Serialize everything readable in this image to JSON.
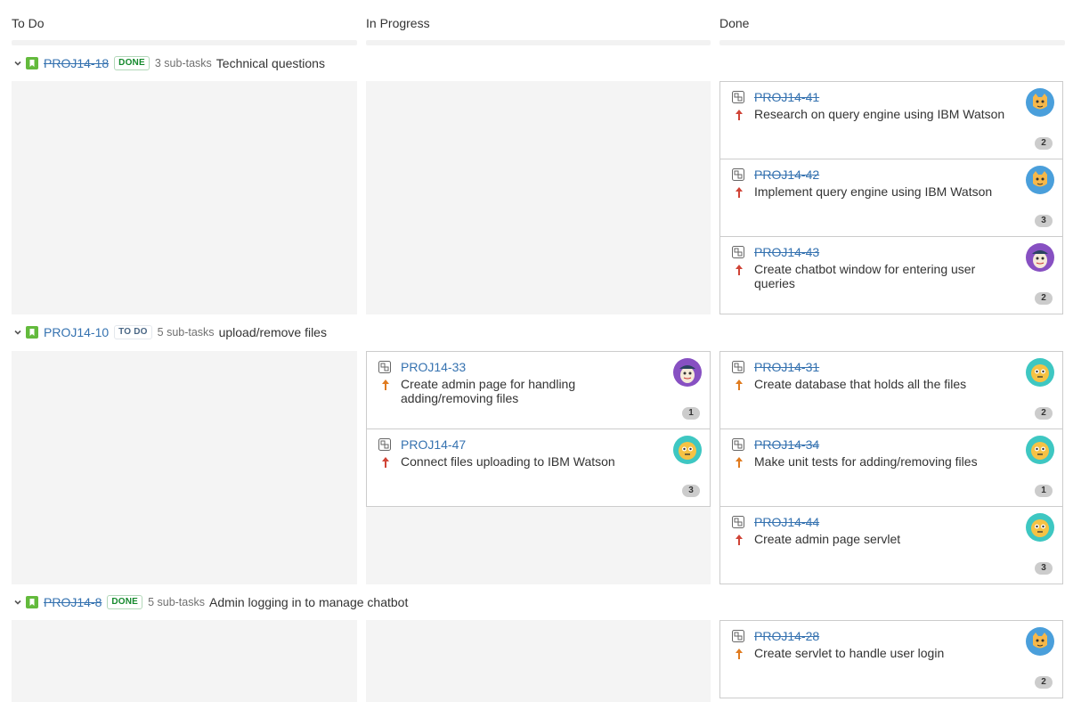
{
  "columns": [
    {
      "title": "To Do"
    },
    {
      "title": "In Progress"
    },
    {
      "title": "Done"
    }
  ],
  "colors": {
    "link": "#3572b0",
    "done_green": "#14892c",
    "story_green": "#63ba3c",
    "priority_high": "#d04437",
    "priority_medium": "#e07b1f"
  },
  "swimlanes": [
    {
      "key": "PROJ14-18",
      "status": "DONE",
      "subtasks": "3 sub-tasks",
      "summary": "Technical questions",
      "done_cards": [
        {
          "key": "PROJ14-41",
          "summary": "Research on query engine using IBM Watson",
          "priority": "high",
          "avatar": "cat-avatar",
          "badge": "2"
        },
        {
          "key": "PROJ14-42",
          "summary": "Implement query engine using IBM Watson",
          "priority": "high",
          "avatar": "cat-avatar",
          "badge": "3"
        },
        {
          "key": "PROJ14-43",
          "summary": "Create chatbot window for entering user queries",
          "priority": "high",
          "avatar": "captain-avatar",
          "badge": "2"
        }
      ]
    },
    {
      "key": "PROJ14-10",
      "status": "TO DO",
      "subtasks": "5 sub-tasks",
      "summary": "upload/remove files",
      "in_progress_cards": [
        {
          "key": "PROJ14-33",
          "summary": "Create admin page for handling adding/removing files",
          "priority": "medium",
          "avatar": "captain-avatar",
          "badge": "1"
        },
        {
          "key": "PROJ14-47",
          "summary": "Connect files uploading to IBM Watson",
          "priority": "high",
          "avatar": "monster-avatar",
          "badge": "3"
        }
      ],
      "done_cards": [
        {
          "key": "PROJ14-31",
          "summary": "Create database that holds all the files",
          "priority": "medium",
          "avatar": "monster-avatar",
          "badge": "2"
        },
        {
          "key": "PROJ14-34",
          "summary": "Make unit tests for adding/removing files",
          "priority": "medium",
          "avatar": "monster-avatar",
          "badge": "1"
        },
        {
          "key": "PROJ14-44",
          "summary": "Create admin page servlet",
          "priority": "high",
          "avatar": "monster-avatar",
          "badge": "3"
        }
      ]
    },
    {
      "key": "PROJ14-8",
      "status": "DONE",
      "subtasks": "5 sub-tasks",
      "summary": "Admin logging in to manage chatbot",
      "done_cards": [
        {
          "key": "PROJ14-28",
          "summary": "Create servlet to handle user login",
          "priority": "medium",
          "avatar": "cat-avatar",
          "badge": "2"
        }
      ]
    }
  ]
}
